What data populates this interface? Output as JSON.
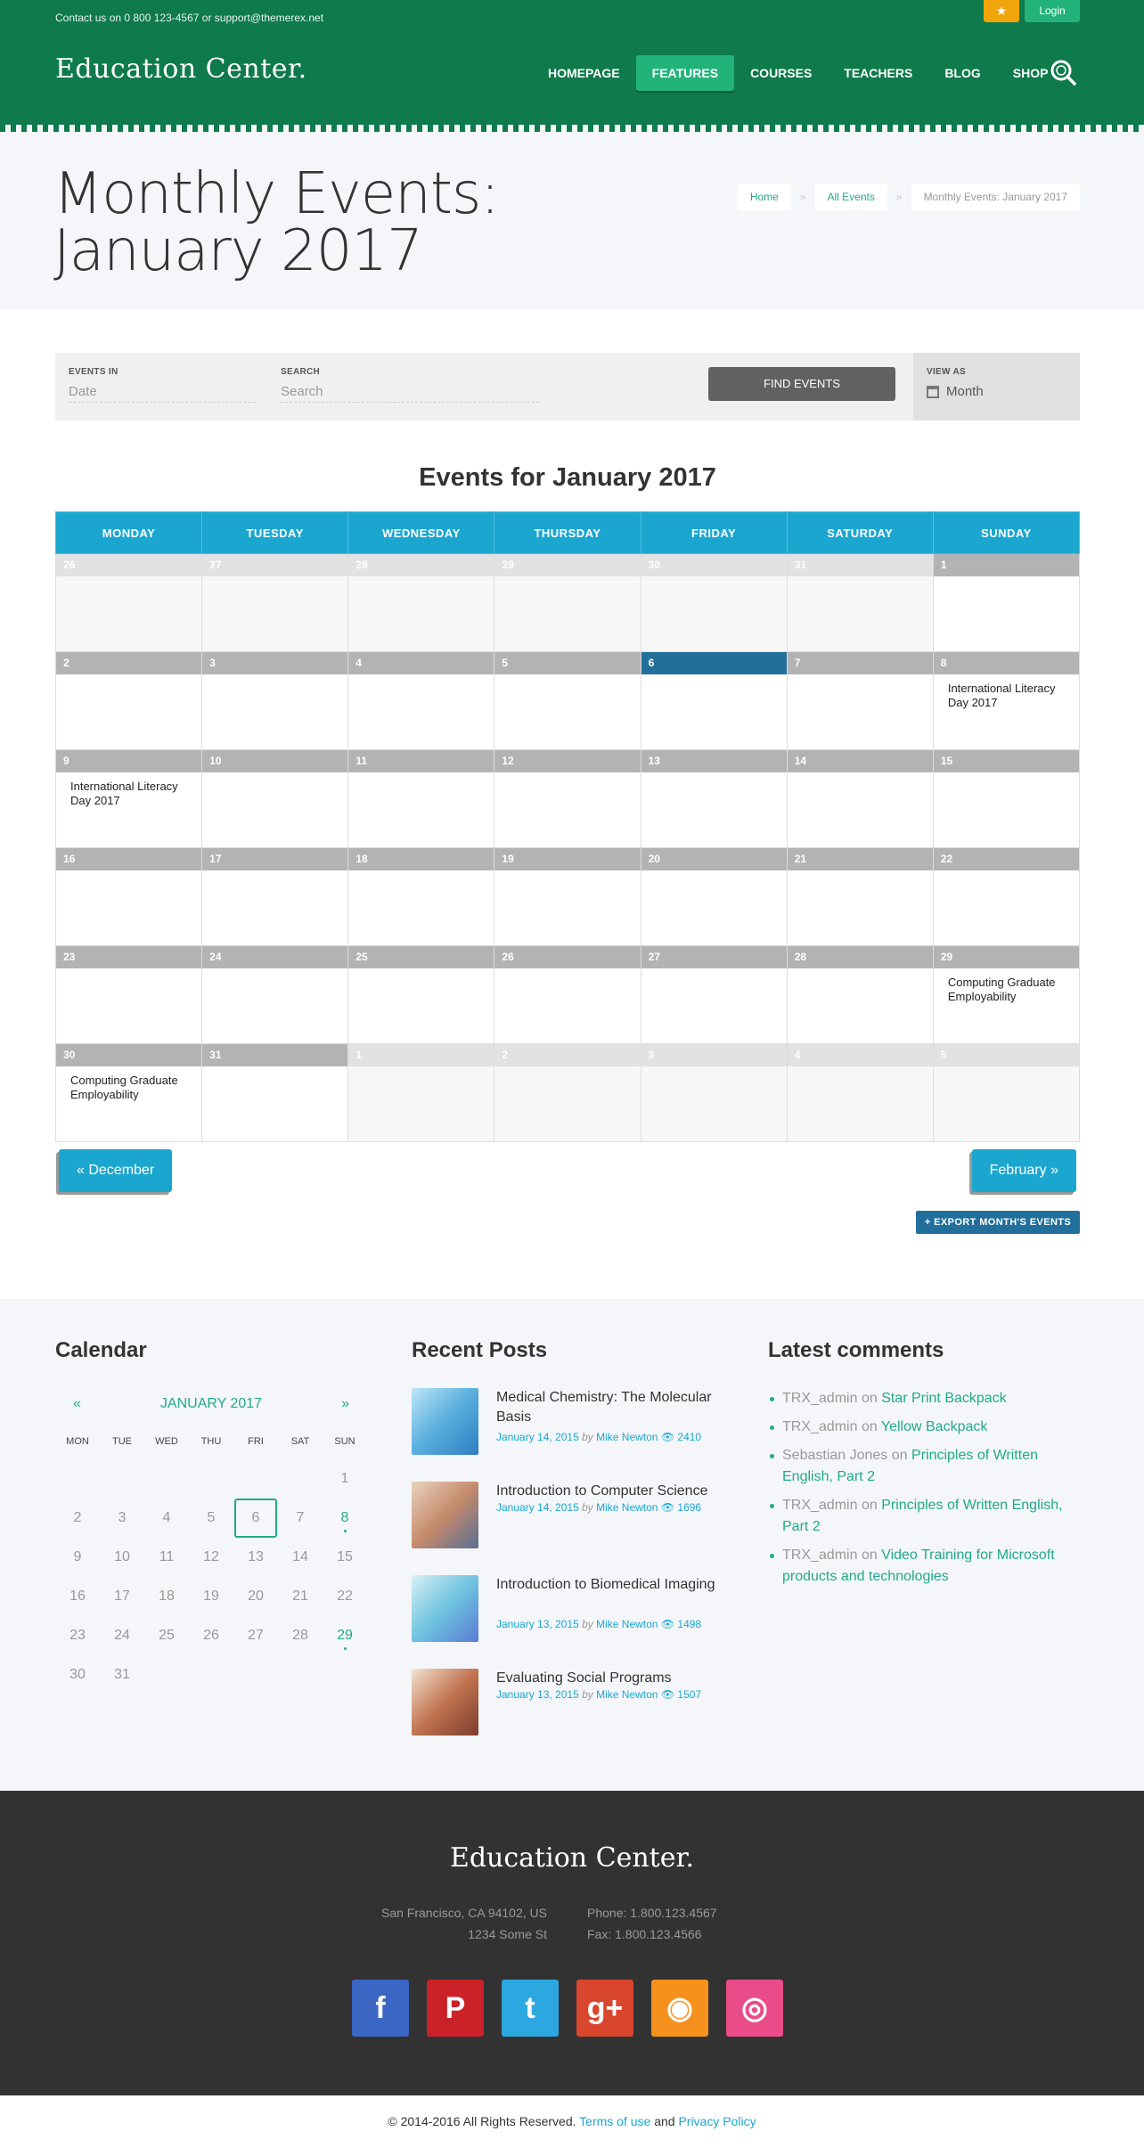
{
  "header": {
    "contact": "Contact us on 0 800 123-4567 or support@themerex.net",
    "login_label": "Login",
    "logo": "Education Center.",
    "nav": [
      "HOMEPAGE",
      "FEATURES",
      "COURSES",
      "TEACHERS",
      "BLOG",
      "SHOP"
    ],
    "active_nav": "FEATURES"
  },
  "title_band": {
    "title": "Monthly Events: January 2017",
    "breadcrumb": [
      "Home",
      "All Events",
      "Monthly Events: January 2017"
    ]
  },
  "filter": {
    "events_in_label": "EVENTS IN",
    "events_in_placeholder": "Date",
    "search_label": "SEARCH",
    "search_placeholder": "Search",
    "find_button": "FIND EVENTS",
    "view_as_label": "VIEW AS",
    "view_as_value": "Month"
  },
  "calendar": {
    "title": "Events for January 2017",
    "weekdays": [
      "MONDAY",
      "TUESDAY",
      "WEDNESDAY",
      "THURSDAY",
      "FRIDAY",
      "SATURDAY",
      "SUNDAY"
    ],
    "weeks": [
      [
        {
          "d": "26",
          "o": true
        },
        {
          "d": "27",
          "o": true
        },
        {
          "d": "28",
          "o": true
        },
        {
          "d": "29",
          "o": true
        },
        {
          "d": "30",
          "o": true
        },
        {
          "d": "31",
          "o": true
        },
        {
          "d": "1"
        }
      ],
      [
        {
          "d": "2"
        },
        {
          "d": "3"
        },
        {
          "d": "4"
        },
        {
          "d": "5"
        },
        {
          "d": "6",
          "today": true
        },
        {
          "d": "7"
        },
        {
          "d": "8",
          "event": "International Literacy Day 2017"
        }
      ],
      [
        {
          "d": "9",
          "event": "International Literacy Day 2017"
        },
        {
          "d": "10"
        },
        {
          "d": "11"
        },
        {
          "d": "12"
        },
        {
          "d": "13"
        },
        {
          "d": "14"
        },
        {
          "d": "15"
        }
      ],
      [
        {
          "d": "16"
        },
        {
          "d": "17"
        },
        {
          "d": "18"
        },
        {
          "d": "19"
        },
        {
          "d": "20"
        },
        {
          "d": "21"
        },
        {
          "d": "22"
        }
      ],
      [
        {
          "d": "23"
        },
        {
          "d": "24"
        },
        {
          "d": "25"
        },
        {
          "d": "26"
        },
        {
          "d": "27"
        },
        {
          "d": "28"
        },
        {
          "d": "29",
          "event": "Computing Graduate Employability"
        }
      ],
      [
        {
          "d": "30",
          "event": "Computing Graduate Employability"
        },
        {
          "d": "31"
        },
        {
          "d": "1",
          "o": true
        },
        {
          "d": "2",
          "o": true
        },
        {
          "d": "3",
          "o": true
        },
        {
          "d": "4",
          "o": true
        },
        {
          "d": "5",
          "o": true
        }
      ]
    ],
    "prev_label": "« December",
    "next_label": "February »",
    "export_label": "+ EXPORT MONTH'S EVENTS"
  },
  "widgets": {
    "calendar_title": "Calendar",
    "mini": {
      "month": "JANUARY 2017",
      "prev": "«",
      "next": "»",
      "dow": [
        "MON",
        "TUE",
        "WED",
        "THU",
        "FRI",
        "SAT",
        "SUN"
      ],
      "days": [
        "",
        "",
        "",
        "",
        "",
        "",
        "1",
        "2",
        "3",
        "4",
        "5",
        "6",
        "7",
        "8",
        "9",
        "10",
        "11",
        "12",
        "13",
        "14",
        "15",
        "16",
        "17",
        "18",
        "19",
        "20",
        "21",
        "22",
        "23",
        "24",
        "25",
        "26",
        "27",
        "28",
        "29",
        "30",
        "31"
      ],
      "event_days": [
        "8",
        "29"
      ],
      "selected_day": "6"
    },
    "posts_title": "Recent Posts",
    "posts": [
      {
        "title": "Medical Chemistry: The Molecular Basis",
        "date": "January 14, 2015",
        "by": "by",
        "author": "Mike Newton",
        "views": "2410"
      },
      {
        "title": "Introduction to Computer Science",
        "date": "January 14, 2015",
        "by": "by",
        "author": "Mike Newton",
        "views": "1696"
      },
      {
        "title": "Introduction to Biomedical Imaging",
        "date": "January 13, 2015",
        "by": "by",
        "author": "Mike Newton",
        "views": "1498"
      },
      {
        "title": "Evaluating Social Programs",
        "date": "January 13, 2015",
        "by": "by",
        "author": "Mike Newton",
        "views": "1507"
      }
    ],
    "comments_title": "Latest comments",
    "comments": [
      {
        "author": "TRX_admin",
        "on": "on",
        "link": "Star Print Backpack"
      },
      {
        "author": "TRX_admin",
        "on": "on",
        "link": "Yellow Backpack"
      },
      {
        "author": "Sebastian Jones",
        "on": "on",
        "link": "Principles of Written English, Part 2"
      },
      {
        "author": "TRX_admin",
        "on": "on",
        "link": "Principles of Written English, Part 2"
      },
      {
        "author": "TRX_admin",
        "on": "on",
        "link": "Video Training for Microsoft products and technologies"
      }
    ]
  },
  "footer": {
    "logo": "Education Center.",
    "address_line1": "San Francisco, CA 94102, US",
    "address_line2": "1234 Some St",
    "phone": "Phone: 1.800.123.4567",
    "fax": "Fax: 1.800.123.4566",
    "social_icons": [
      "facebook-icon",
      "pinterest-icon",
      "twitter-icon",
      "google-plus-icon",
      "rss-icon",
      "dribbble-icon"
    ],
    "social_colors": [
      "#3b66c4",
      "#cb2128",
      "#2ca7e0",
      "#d9462e",
      "#f6911e",
      "#ea4c89"
    ],
    "copyright": "© 2014-2016 All Rights Reserved.",
    "terms": "Terms of use",
    "and": "and",
    "privacy": "Privacy Policy"
  },
  "colors": {
    "header_green": "#0f7a4c",
    "accent_green": "#22b37b",
    "calendar_blue": "#1ba6d0",
    "today_blue": "#236f9b"
  }
}
